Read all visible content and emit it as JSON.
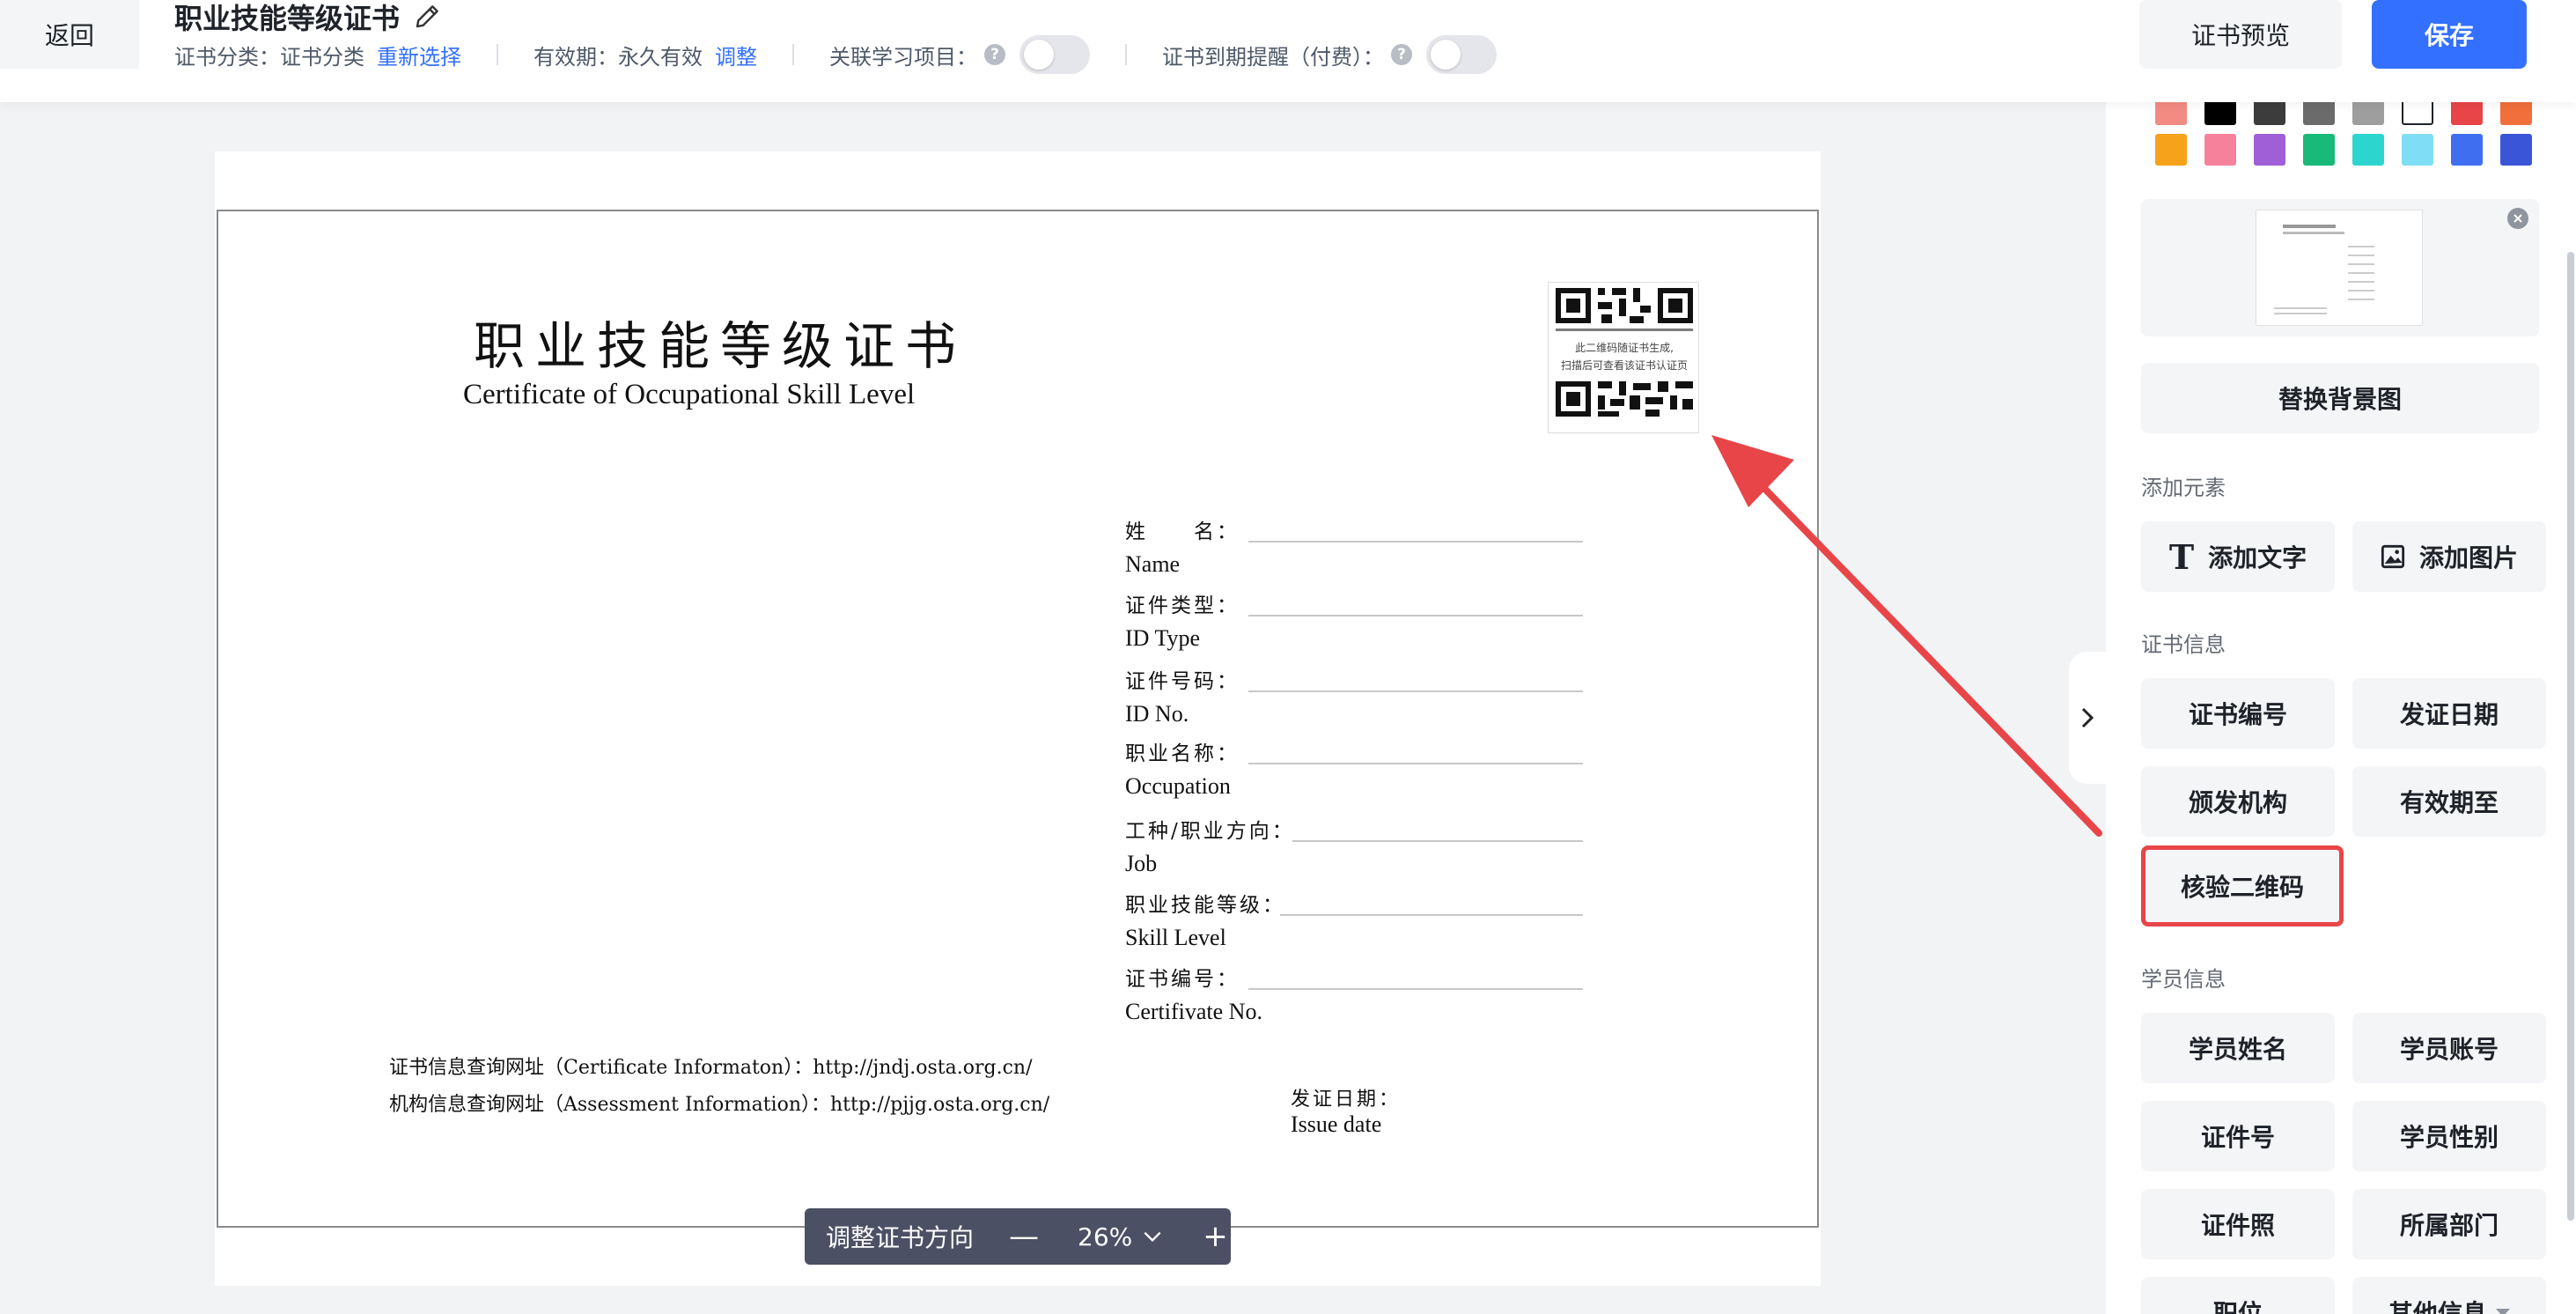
{
  "header": {
    "back_label": "返回",
    "title": "职业技能等级证书",
    "category_label": "证书分类：",
    "category_value": "证书分类",
    "reselect_link": "重新选择",
    "validity_label": "有效期：",
    "validity_value": "永久有效",
    "adjust_link": "调整",
    "link_project_label": "关联学习项目：",
    "expiry_reminder_label": "证书到期提醒（付费）：",
    "help_glyph": "?",
    "preview_label": "证书预览",
    "save_label": "保存"
  },
  "certificate": {
    "title_cn": "职业技能等级证书",
    "title_en": "Certificate of Occupational Skill Level",
    "qr_caption_1": "此二维码随证书生成,",
    "qr_caption_2": "扫描后可查看该证书认证页",
    "fields": [
      {
        "cn": "姓　　名：",
        "en": "Name"
      },
      {
        "cn": "证件类型：",
        "en": "ID Type"
      },
      {
        "cn": "证件号码：",
        "en": "ID No."
      },
      {
        "cn": "职业名称：",
        "en": "Occupation"
      },
      {
        "cn": "工种/职业方向：",
        "en": "Job"
      },
      {
        "cn": "职业技能等级：",
        "en": "Skill Level"
      },
      {
        "cn": "证书编号：",
        "en": "Certifivate No."
      }
    ],
    "footer_line_1": "证书信息查询网址（Certificate Informaton）：http://jndj.osta.org.cn/",
    "footer_line_2": "机构信息查询网址（Assessment Information）：http://pjjg.osta.org.cn/",
    "issue_date_cn": "发证日期：",
    "issue_date_en": "Issue date"
  },
  "zoom": {
    "orientation_label": "调整证书方向",
    "zoom_out": "—",
    "value": "26%",
    "zoom_in": "+"
  },
  "panel": {
    "swatches_row1": [
      "#f28b82",
      "#000000",
      "#3c3c3c",
      "#6b6b6b",
      "#9e9e9e",
      "#ffffff",
      "#e84548",
      "#f06f3b"
    ],
    "swatches_row2": [
      "#f7a21b",
      "#f5819b",
      "#a05fd6",
      "#19b97a",
      "#2cd6cf",
      "#7fdef5",
      "#3f6ff0",
      "#3a55d8"
    ],
    "replace_bg_label": "替换背景图",
    "add_elements_title": "添加元素",
    "add_text_label": "添加文字",
    "add_image_label": "添加图片",
    "cert_info_title": "证书信息",
    "cert_number": "证书编号",
    "issue_date": "发证日期",
    "issuer": "颁发机构",
    "valid_until": "有效期至",
    "verify_qr": "核验二维码",
    "student_info_title": "学员信息",
    "student_name": "学员姓名",
    "student_account": "学员账号",
    "id_number": "证件号",
    "student_gender": "学员性别",
    "id_photo": "证件照",
    "department": "所属部门",
    "position": "职位",
    "other_info": "其他信息"
  },
  "colors": {
    "primary": "#3370ff",
    "highlight": "#e84548",
    "arrow": "#e84548"
  }
}
